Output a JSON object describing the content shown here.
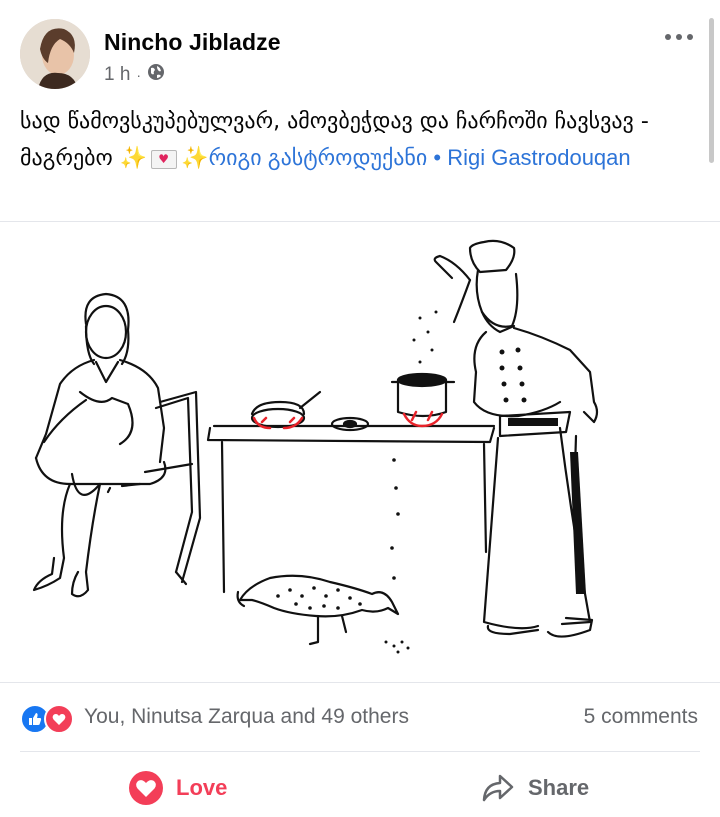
{
  "post": {
    "author": "Nincho Jibladze",
    "time": "1 h",
    "separator": "·",
    "text_part1": "სად წამოვსკუპებულვარ, ამოვბეჭდავ და ჩარჩოში ჩავსვავ - მაგრებო",
    "sparkle_1": "✨",
    "sparkle_2": "✨",
    "link_text": "რიგი გასტროდუქანი • Rigi Gastrodouqan"
  },
  "reactions": {
    "summary": "You, Ninutsa Zarqua and 49 others",
    "comments": "5 comments"
  },
  "actions": {
    "love_label": "Love",
    "share_label": "Share"
  },
  "icons": {
    "privacy": "globe-icon",
    "more": "more-options-icon",
    "like_reaction": "like-reaction-icon",
    "love_reaction": "love-reaction-icon",
    "love_button": "love-icon",
    "share_button": "share-icon"
  },
  "colors": {
    "link": "#2d74d8",
    "love": "#f33e58",
    "like": "#1877f2",
    "secondary_text": "#65676b",
    "flame": "#e8232a"
  }
}
